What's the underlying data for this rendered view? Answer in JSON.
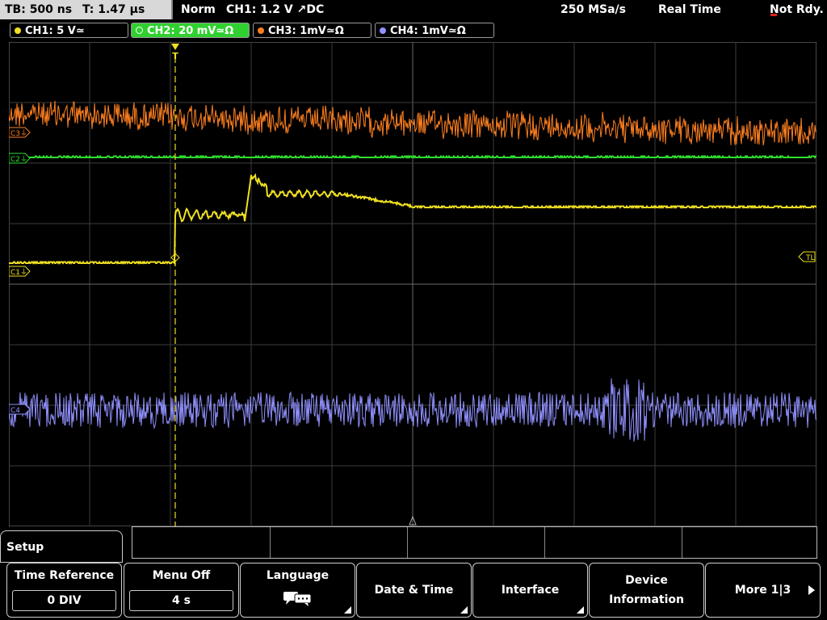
{
  "topbar": {
    "timebase": "TB: 500 ns",
    "trigger_pos": "T: 1.47 µs",
    "mode": "Norm",
    "trigger": "CH1: 1.2 V ↗DC",
    "sample_rate": "250 MSa/s",
    "acq": "Real Time",
    "status": "Not Rdy."
  },
  "channels": [
    {
      "label": "CH1: 5 V≃",
      "color": "#f0e020",
      "active": false
    },
    {
      "label": "CH2: 20 mV≃Ω",
      "color": "#30e030",
      "active": true
    },
    {
      "label": "CH3: 1mV≃Ω",
      "color": "#ff8020",
      "active": false
    },
    {
      "label": "CH4: 1mV≃Ω",
      "color": "#9090ff",
      "active": false
    }
  ],
  "markers": {
    "c3": "C3⏚",
    "c2": "C2⏚",
    "c1": "C1⏚",
    "c4": "C4",
    "tl": "TL",
    "trig": "T"
  },
  "menu": {
    "title": "Setup",
    "softkeys": [
      {
        "label": "Time Reference",
        "value": "0 DIV"
      },
      {
        "label": "Menu Off",
        "value": "4 s"
      },
      {
        "label": "Language",
        "icon": "speech-bubbles-icon"
      },
      {
        "label": "Date & Time"
      },
      {
        "label": "Interface"
      },
      {
        "label": "Device Information"
      },
      {
        "label": "More 1|3"
      }
    ]
  },
  "colors": {
    "ch1": "#f0e020",
    "ch2": "#30e030",
    "ch3": "#ff8020",
    "ch4": "#9090ff",
    "grid": "#505050"
  }
}
